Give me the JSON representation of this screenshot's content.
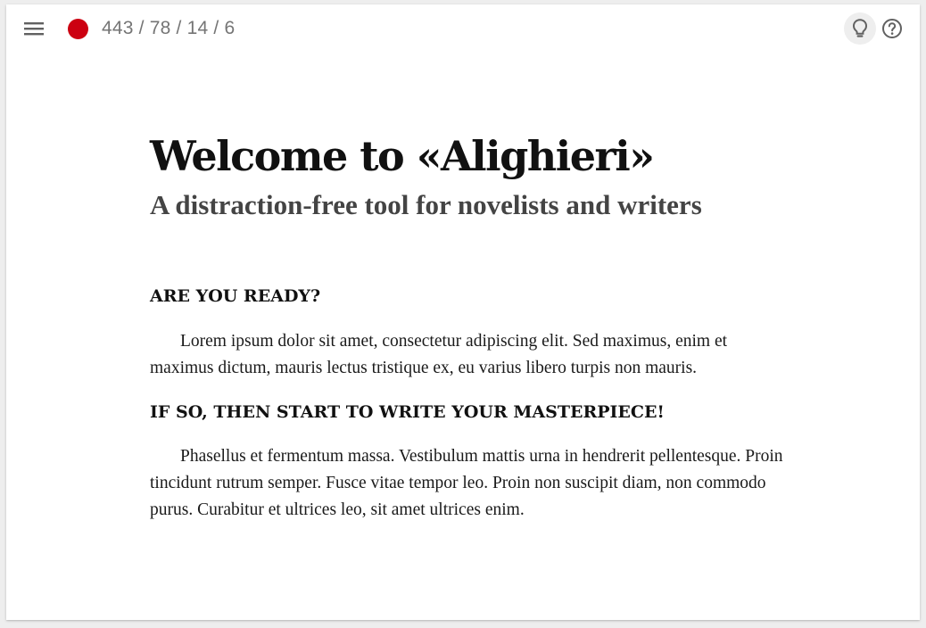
{
  "toolbar": {
    "menu_icon": "hamburger-menu-icon",
    "status_color": "#cc0011",
    "stats": "443 / 78 / 14 / 6",
    "tips_icon": "lightbulb-icon",
    "help_icon": "help-circle-icon"
  },
  "document": {
    "title": "Welcome to «Alighieri»",
    "subtitle": "A distraction-free tool for novelists and writers",
    "sections": [
      {
        "heading": "ARE YOU READY?",
        "body": "Lorem ipsum dolor sit amet, consectetur adipiscing elit. Sed maximus, enim et maximus dictum, mauris lectus tristique ex, eu varius libero turpis non mauris."
      },
      {
        "heading": "IF SO, THEN START TO WRITE YOUR MASTERPIECE!",
        "body": "Phasellus et fermentum massa. Vestibulum mattis urna in hendrerit pellentesque. Proin tincidunt rutrum semper. Fusce vitae tempor leo. Proin non suscipit diam, non commodo purus. Curabitur et ultrices leo, sit amet ultrices enim."
      }
    ]
  }
}
